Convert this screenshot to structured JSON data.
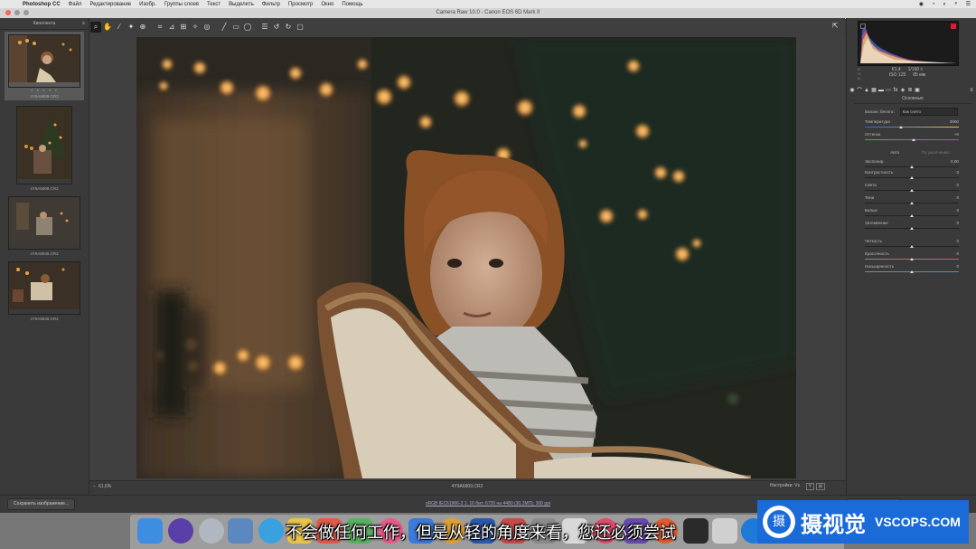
{
  "menubar": {
    "app": "Photoshop CC",
    "items": [
      "Файл",
      "Редактирование",
      "Изобр.",
      "Группы слоев",
      "Текст",
      "Выделить",
      "Фильтр",
      "Просмотр",
      "Окно",
      "Помощь"
    ]
  },
  "window": {
    "title": "Camera Raw 10.0 - Canon EOS 6D Mark II"
  },
  "filmstrip": {
    "header": "Кинолента",
    "stars": "★ ★ ★ ★ ★",
    "thumbs": [
      {
        "name": "4Y9A6909.CR2"
      },
      {
        "name": "4Y9A6908.CR2"
      },
      {
        "name": "4Y9A6845.CR2"
      },
      {
        "name": "4Y9A6846.CR2"
      }
    ]
  },
  "statusbar": {
    "zoom": "61,6%",
    "filename": "4Y9A6909.CR2",
    "y_label": "Y",
    "nav_label": "Настройки: Vs"
  },
  "camera_info": {
    "aperture": "f/1,4",
    "shutter": "1/160 с",
    "iso": "ISO 125",
    "focal": "85 мм"
  },
  "panel": {
    "title": "Основные",
    "wb_label": "Баланс белого:",
    "wb_value": "Как снято",
    "tone_auto": "Авто",
    "tone_default": "По умолчанию",
    "sliders": [
      {
        "label": "Температура",
        "value": "3900",
        "pos": 0.38
      },
      {
        "label": "Оттенок",
        "value": "+6",
        "pos": 0.52
      },
      {
        "label": "Экспонир.",
        "value": "0,00",
        "pos": 0.5
      },
      {
        "label": "Контрастность",
        "value": "0",
        "pos": 0.5
      },
      {
        "label": "Света",
        "value": "0",
        "pos": 0.5
      },
      {
        "label": "Тени",
        "value": "0",
        "pos": 0.5
      },
      {
        "label": "Белые",
        "value": "0",
        "pos": 0.5
      },
      {
        "label": "Затемнение",
        "value": "0",
        "pos": 0.5
      },
      {
        "label": "Четкость",
        "value": "0",
        "pos": 0.5
      },
      {
        "label": "Красочность",
        "value": "0",
        "pos": 0.5
      },
      {
        "label": "Насыщенность",
        "value": "0",
        "pos": 0.5
      }
    ]
  },
  "bottombar": {
    "save_label": "Сохранить изображение...",
    "workflow": "sRGB IEC61966-2.1; 16 бит; 6720 на 4480 (30,1МП); 300 ppi"
  },
  "subtitle": "不会做任何工作，但是从轻的角度来看，您还必须尝试",
  "watermark": {
    "logo_char": "摄",
    "cn": "摄视觉",
    "en": "VSCOPS.COM"
  },
  "colors": {
    "panel_bg": "#3a3a3a",
    "accent_blue": "#1a6ad8"
  }
}
